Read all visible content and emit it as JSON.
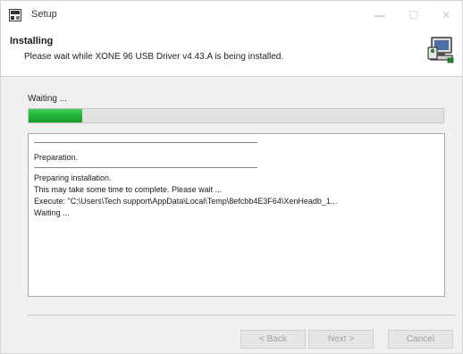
{
  "window": {
    "title": "Setup",
    "controls": {
      "minimize": "—",
      "maximize": "☐",
      "close": "✕"
    }
  },
  "header": {
    "title": "Installing",
    "subtitle": "Please wait while XONE 96 USB Driver v4.43.A is being installed.",
    "icon": "installer-computer-icon"
  },
  "status": {
    "text": "Waiting ...",
    "progress_fraction": 0.13,
    "progress_color": "#1fae36"
  },
  "log": {
    "lines": [
      "Preparation.",
      "Preparing installation.",
      "This may take some time to complete. Please wait ...",
      "Execute: \"C:\\Users\\Tech support\\AppData\\Local\\Temp\\8efcbb4E3F64\\XenHeadb_1...",
      "Waiting ..."
    ]
  },
  "buttons": {
    "back": "< Back",
    "next": "Next >",
    "cancel": "Cancel"
  }
}
